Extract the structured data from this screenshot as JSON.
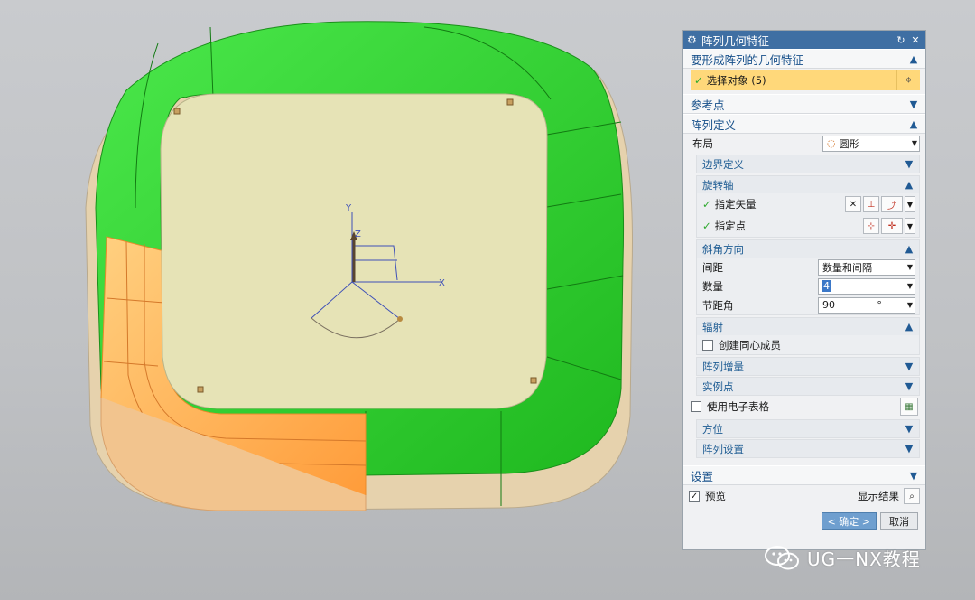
{
  "dialog": {
    "title": "阵列几何特征",
    "sections": {
      "geometry": {
        "title": "要形成阵列的几何特征",
        "select_label": "选择对象 (5)"
      },
      "reference": {
        "title": "参考点"
      },
      "definition": {
        "title": "阵列定义",
        "layout_label": "布局",
        "layout_value": "圆形",
        "boundary": {
          "title": "边界定义"
        },
        "rotation_axis": {
          "title": "旋转轴",
          "vector_label": "指定矢量",
          "point_label": "指定点"
        },
        "angular_direction": {
          "title": "斜角方向",
          "spacing_label": "间距",
          "spacing_value": "数量和间隔",
          "count_label": "数量",
          "count_value": "4",
          "pitch_label": "节距角",
          "pitch_value": "90",
          "pitch_unit": "°"
        },
        "radial": {
          "title": "辐射",
          "concentric_label": "创建同心成员"
        },
        "increment": {
          "title": "阵列增量"
        },
        "instance_points": {
          "title": "实例点"
        },
        "spreadsheet_label": "使用电子表格",
        "orientation": {
          "title": "方位"
        },
        "pattern_settings": {
          "title": "阵列设置"
        }
      },
      "settings": {
        "title": "设置"
      }
    },
    "preview_label": "预览",
    "show_result_label": "显示结果",
    "ok_label": "< 确定 >",
    "cancel_label": "取消"
  },
  "viewport": {
    "axis_x": "X",
    "axis_y": "Y",
    "axis_z": "Z"
  },
  "watermark": {
    "text": "UG一NX教程"
  },
  "colors": {
    "title_bar": "#3f6fa3",
    "section_header": "#17508a",
    "selection_highlight": "#ffd87a",
    "model_green": "#2fd62f",
    "model_orange": "#ffb14d",
    "model_base": "#e8d5b3",
    "floor_face": "#e6e3b6"
  }
}
